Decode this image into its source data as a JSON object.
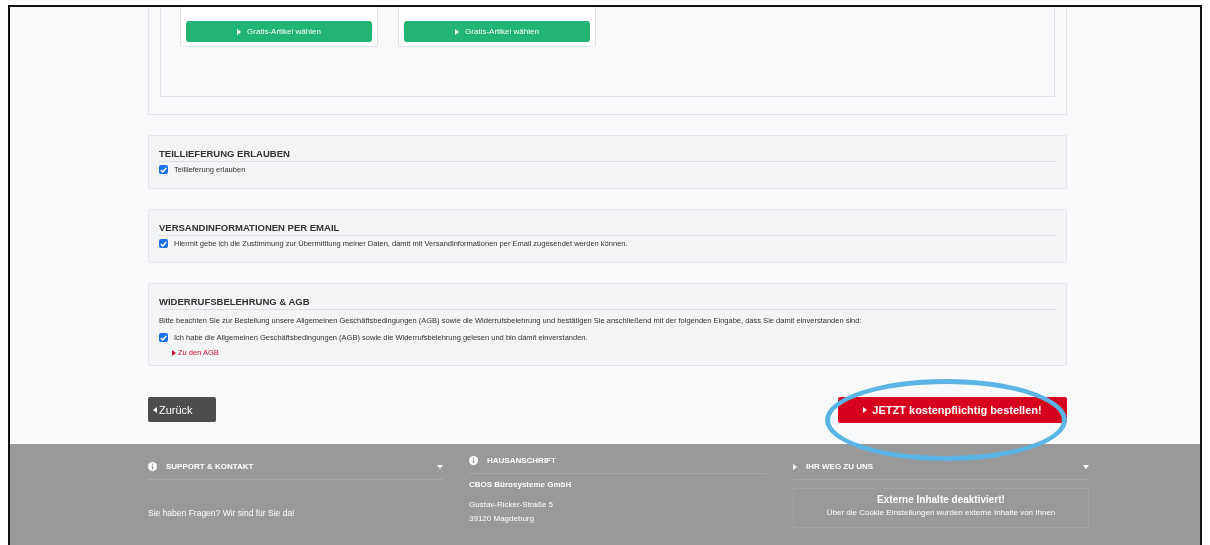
{
  "gift_buttons": [
    {
      "label": "Gratis-Artikel wählen"
    },
    {
      "label": "Gratis-Artikel wählen"
    }
  ],
  "sections": [
    {
      "title": "TEILLIEFERUNG ERLAUBEN",
      "checkboxes": [
        {
          "label": "Teillieferung erlauben",
          "checked": true
        }
      ]
    },
    {
      "title": "VERSANDINFORMATIONEN PER EMAIL",
      "checkboxes": [
        {
          "label": "Hiermit gebe ich die Zustimmung zur Übermittlung meiner Daten, damit mit Versandinformationen per Email zugesendet werden können.",
          "checked": true
        }
      ]
    },
    {
      "title": "WIDERRUFSBELEHRUNG & AGB",
      "intro": "Bitte beachten Sie zur Bestellung unsere Allgemeinen Geschäftsbedingungen (AGB) sowie die Widerrufsbelehrung und bestätigen Sie anschließend mit der folgenden Eingabe, dass Sie damit einverstanden sind:",
      "checkboxes": [
        {
          "label": "Ich habe die Allgemeinen Geschäftsbedingungen (AGB) sowie die Widerrufsbelehrung gelesen und bin damit einverstanden.",
          "checked": true
        }
      ],
      "link": "Zu den AGB"
    }
  ],
  "back_button": "Zurück",
  "order_button": "JETZT kostenpflichtig bestellen!",
  "footer": {
    "support": {
      "title": "SUPPORT & KONTAKT",
      "text": "Sie haben Fragen? Wir sind für Sie da!"
    },
    "address": {
      "title": "HAUSANSCHRIFT",
      "company": "CBOS Bürosysteme GmbH",
      "lines": [
        "Gustav-Ricker-Straße 5",
        "39120 Magdeburg"
      ]
    },
    "directions": {
      "title": "IHR WEG ZU UNS",
      "notice_title": "Externe Inhalte deaktiviert!",
      "notice_text": "Über die Cookie Einstellungen wurden externe Inhalte von Ihnen"
    }
  }
}
